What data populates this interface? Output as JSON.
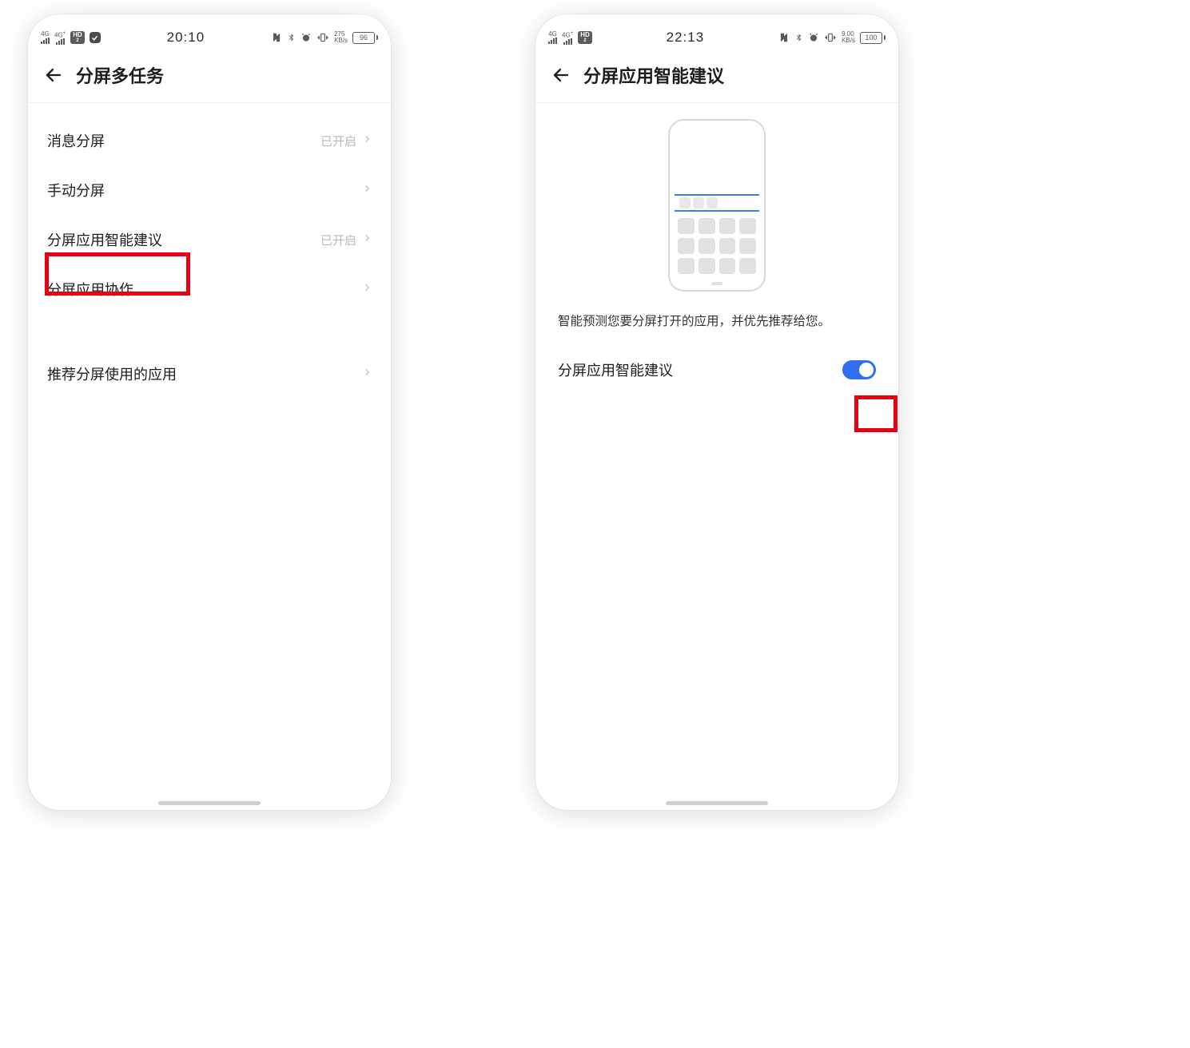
{
  "left": {
    "statusbar": {
      "sig1_label": "4G",
      "sig2_label": "4G",
      "sig2_plus": "+",
      "hd_label": "HD",
      "hd_sub": "2",
      "time": "20:10",
      "kbs_top": "275",
      "kbs_bot": "KB/s",
      "battery": "96"
    },
    "header_title": "分屏多任务",
    "rows": {
      "r0": {
        "label": "消息分屏",
        "status": "已开启"
      },
      "r1": {
        "label": "手动分屏",
        "status": ""
      },
      "r2": {
        "label": "分屏应用智能建议",
        "status": "已开启"
      },
      "r3": {
        "label": "分屏应用协作",
        "status": ""
      },
      "r4": {
        "label": "推荐分屏使用的应用",
        "status": ""
      }
    }
  },
  "right": {
    "statusbar": {
      "sig1_label": "4G",
      "sig2_label": "4G",
      "sig2_plus": "+",
      "hd_label": "HD",
      "hd_sub": "2",
      "time": "22:13",
      "kbs_top": "9.00",
      "kbs_bot": "KB/s",
      "battery": "100"
    },
    "header_title": "分屏应用智能建议",
    "description": "智能预测您要分屏打开的应用，并优先推荐给您。",
    "toggle_label": "分屏应用智能建议",
    "toggle_on": true
  }
}
